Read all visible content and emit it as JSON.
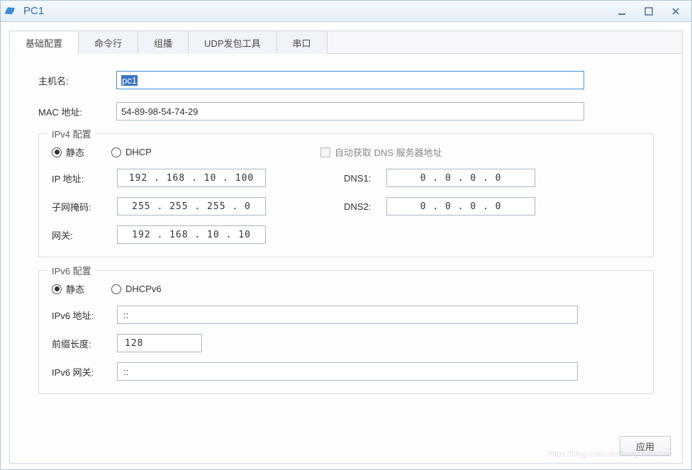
{
  "window": {
    "title": "PC1"
  },
  "tabs": [
    {
      "label": "基础配置",
      "active": true
    },
    {
      "label": "命令行",
      "active": false
    },
    {
      "label": "组播",
      "active": false
    },
    {
      "label": "UDP发包工具",
      "active": false
    },
    {
      "label": "串口",
      "active": false
    }
  ],
  "basic": {
    "hostname_label": "主机名:",
    "hostname_value": "pc1",
    "mac_label": "MAC 地址:",
    "mac_value": "54-89-98-54-74-29"
  },
  "ipv4": {
    "legend": "IPv4 配置",
    "radio_static": "静态",
    "radio_dhcp": "DHCP",
    "auto_dns_label": "自动获取 DNS 服务器地址",
    "ip_label": "IP 地址:",
    "ip_value": "192 . 168 .  10  . 100",
    "mask_label": "子网掩码:",
    "mask_value": "255 . 255 . 255 .  0",
    "gw_label": "网关:",
    "gw_value": "192 . 168 .  10  .  10",
    "dns1_label": "DNS1:",
    "dns1_value": "0  .  0  .  0  .  0",
    "dns2_label": "DNS2:",
    "dns2_value": "0  .  0  .  0  .  0"
  },
  "ipv6": {
    "legend": "IPv6 配置",
    "radio_static": "静态",
    "radio_dhcpv6": "DHCPv6",
    "addr_label": "IPv6 地址:",
    "addr_value": "::",
    "prefix_label": "前缀长度:",
    "prefix_value": "128",
    "gw_label": "IPv6 网关:",
    "gw_value": "::"
  },
  "buttons": {
    "apply": "应用"
  },
  "watermark": "https://blog.csdn.net/Songchenchen"
}
